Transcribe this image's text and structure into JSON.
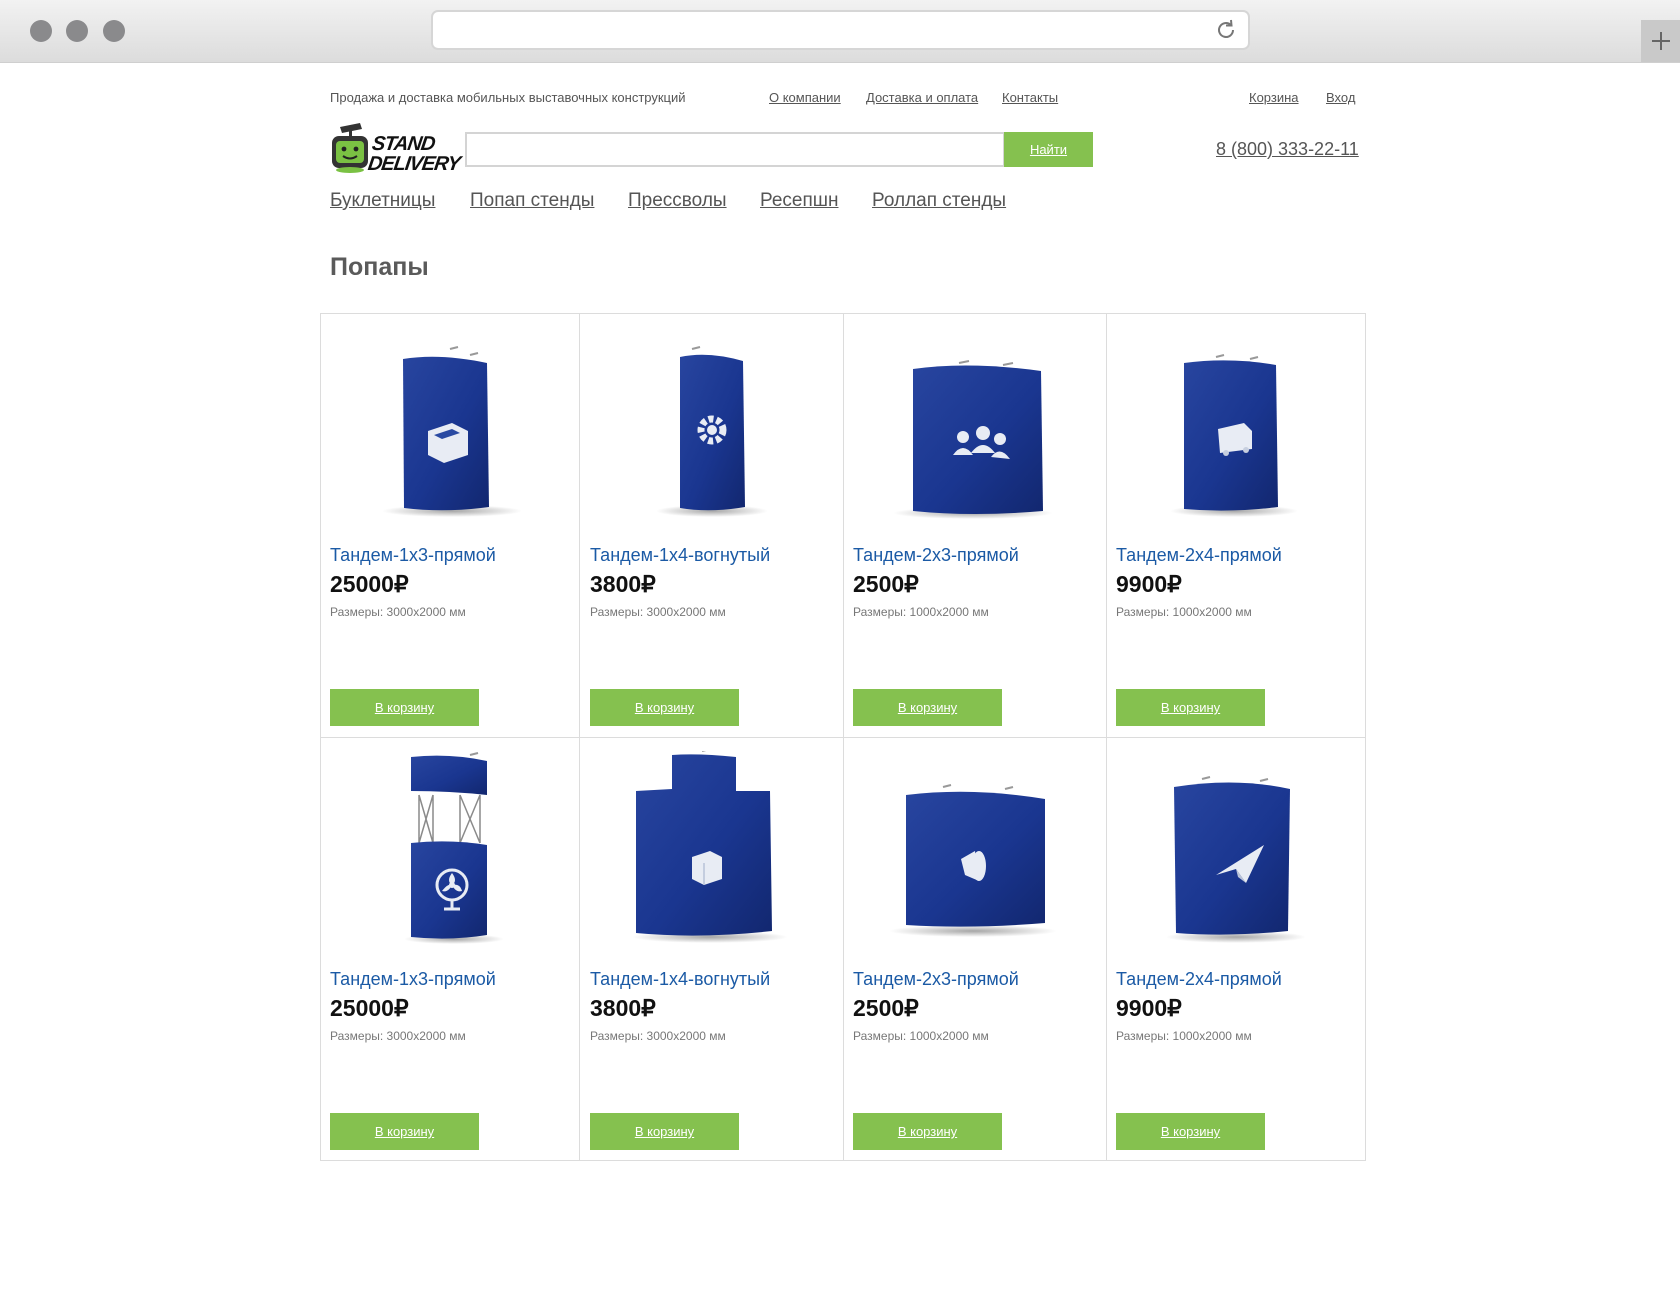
{
  "header": {
    "tagline": "Продажа и доставка мобильных выставочных конструкций",
    "links": [
      "О компании",
      "Доставка и оплата",
      "Контакты"
    ],
    "cart_label": "Корзина",
    "login_label": "Вход",
    "phone": "8 (800) 333-22-11",
    "search_button": "Найти",
    "search_value": ""
  },
  "logo": {
    "line1": "STAND",
    "line2": "DELIVERY"
  },
  "nav": [
    "Буклетницы",
    "Попап стенды",
    "Прессволы",
    "Ресепшн",
    "Роллап стенды"
  ],
  "page_title": "Попапы",
  "products": [
    {
      "name": "Тандем-1х3-прямой",
      "price": "25000₽",
      "size": "Размеры: 3000х2000 мм",
      "cart": "В корзину",
      "icon": "box-icon"
    },
    {
      "name": "Тандем-1х4-вогнутый",
      "price": "3800₽",
      "size": "Размеры: 3000х2000 мм",
      "cart": "В корзину",
      "icon": "gear-icon"
    },
    {
      "name": "Тандем-2х3-прямой",
      "price": "2500₽",
      "size": "Размеры: 1000х2000 мм",
      "cart": "В корзину",
      "icon": "people-icon"
    },
    {
      "name": "Тандем-2х4-прямой",
      "price": "9900₽",
      "size": "Размеры: 1000х2000 мм",
      "cart": "В корзину",
      "icon": "truck-icon"
    },
    {
      "name": "Тандем-1х3-прямой",
      "price": "25000₽",
      "size": "Размеры: 3000х2000 мм",
      "cart": "В корзину",
      "icon": "fan-icon"
    },
    {
      "name": "Тандем-1х4-вогнутый",
      "price": "3800₽",
      "size": "Размеры: 3000х2000 мм",
      "cart": "В корзину",
      "icon": "cube-icon"
    },
    {
      "name": "Тандем-2х3-прямой",
      "price": "2500₽",
      "size": "Размеры: 1000х2000 мм",
      "cart": "В корзину",
      "icon": "megaphone-icon"
    },
    {
      "name": "Тандем-2х4-прямой",
      "price": "9900₽",
      "size": "Размеры: 1000х2000 мм",
      "cart": "В корзину",
      "icon": "plane-icon"
    }
  ],
  "colors": {
    "accent": "#85c14f",
    "link": "#1b5aa5",
    "stand": "#1e3c9a"
  }
}
